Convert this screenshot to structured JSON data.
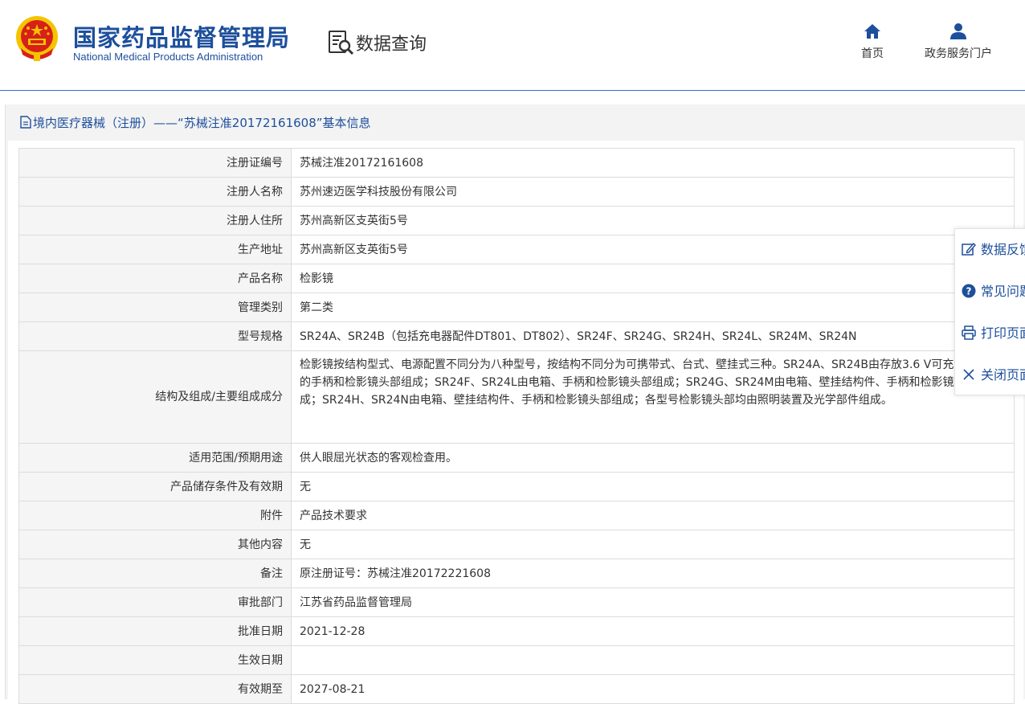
{
  "header": {
    "logo_cn": "国家药品监督管理局",
    "logo_en": "National Medical Products Administration",
    "query_label": "数据查询",
    "nav": [
      {
        "label": "首页",
        "icon": "home-icon"
      },
      {
        "label": "政务服务门户",
        "icon": "user-icon"
      }
    ]
  },
  "section": {
    "title": "境内医疗器械（注册）——“苏械注准20172161608”基本信息"
  },
  "detail": {
    "rows": [
      {
        "label": "注册证编号",
        "value": "苏械注准20172161608"
      },
      {
        "label": "注册人名称",
        "value": "苏州速迈医学科技股份有限公司"
      },
      {
        "label": "注册人住所",
        "value": "苏州高新区支英街5号"
      },
      {
        "label": "生产地址",
        "value": "苏州高新区支英街5号"
      },
      {
        "label": "产品名称",
        "value": "检影镜"
      },
      {
        "label": "管理类别",
        "value": "第二类"
      },
      {
        "label": "型号规格",
        "value": "SR24A、SR24B（包括充电器配件DT801、DT802）、SR24F、SR24G、SR24H、SR24L、SR24M、SR24N"
      },
      {
        "label": "结构及组成/主要组成成分",
        "value": "检影镜按结构型式、电源配置不同分为八种型号，按结构不同分为可携带式、台式、壁挂式三种。SR24A、SR24B由存放3.6 V可充电锂电池的手柄和检影镜头部组成；SR24F、SR24L由电箱、手柄和检影镜头部组成；SR24G、SR24M由电箱、壁挂结构件、手柄和检影镜头部组成；SR24H、SR24N由电箱、壁挂结构件、手柄和检影镜头部组成；各型号检影镜头部均由照明装置及光学部件组成。"
      },
      {
        "label": "适用范围/预期用途",
        "value": "供人眼屈光状态的客观检查用。"
      },
      {
        "label": "产品储存条件及有效期",
        "value": "无"
      },
      {
        "label": "附件",
        "value": "产品技术要求"
      },
      {
        "label": "其他内容",
        "value": "无"
      },
      {
        "label": "备注",
        "value": "原注册证号：苏械注准20172221608"
      },
      {
        "label": "审批部门",
        "value": "江苏省药品监督管理局"
      },
      {
        "label": "批准日期",
        "value": "2021-12-28"
      },
      {
        "label": "生效日期",
        "value": ""
      },
      {
        "label": "有效期至",
        "value": "2027-08-21"
      }
    ]
  },
  "float_menu": [
    {
      "label": "数据反馈",
      "icon": "edit-icon"
    },
    {
      "label": "常见问题",
      "icon": "question-icon"
    },
    {
      "label": "打印页面",
      "icon": "printer-icon"
    },
    {
      "label": "关闭页面",
      "icon": "close-icon"
    }
  ],
  "colors": {
    "brand": "#1d4f9c",
    "emblem_red": "#d7201a",
    "emblem_gold": "#f5c400"
  }
}
